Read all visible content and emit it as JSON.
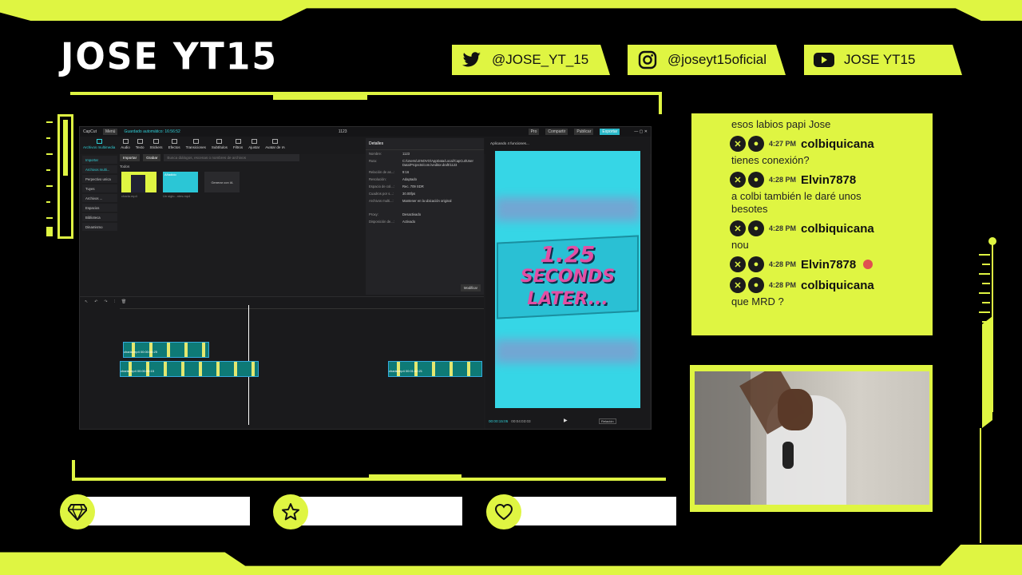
{
  "brand": {
    "name": "JOSE YT15",
    "accent": "#dff542"
  },
  "socials": [
    {
      "icon": "twitter-icon",
      "handle": "@JOSE_YT_15"
    },
    {
      "icon": "instagram-icon",
      "handle": "@joseyt15oficial"
    },
    {
      "icon": "youtube-icon",
      "handle": "JOSE YT15"
    }
  ],
  "editor": {
    "app_name": "CapCut",
    "menu_label": "Menú",
    "autosave": "Guardado automático: 16:56:52",
    "project_title": "1123",
    "top_buttons": [
      "Pro",
      "Compartir",
      "Publicar",
      "Exportar"
    ],
    "toolbar": [
      "Archivos multimedia",
      "Audio",
      "Texto",
      "Stickers",
      "Efectos",
      "Transiciones",
      "Subtítulos",
      "Filtros",
      "Ajustar",
      "Avatar de IA"
    ],
    "sidebar": [
      "Importar",
      "Archivos multi...",
      "Perpectivo unica",
      "Tuyes",
      "Archivos ...",
      "Espacios",
      "Biblioteca",
      "Dinamismo"
    ],
    "media_buttons": [
      "Importar",
      "Grabar"
    ],
    "search_placeholder": "Busca diálogos, escenas o nombres de archivos",
    "filter_label": "Todos",
    "thumbs": [
      {
        "name": "charla.mp4",
        "tag": ""
      },
      {
        "name": "Un siglo...ntes.mp4",
        "tag": "Añadido"
      },
      {
        "name": "Generar con IA",
        "tag": ""
      }
    ],
    "details": {
      "title": "Detalles",
      "rows": [
        {
          "k": "Nombre:",
          "v": "1123"
        },
        {
          "k": "Ruta:",
          "v": "C:/Users/LENOVO/AppData/Local/CapCut/User Data/Projects/com.lveditor.draft/1123"
        },
        {
          "k": "Relación de as...:",
          "v": "9:16"
        },
        {
          "k": "Resolución:",
          "v": "Adaptado"
        },
        {
          "k": "Espacio de col...:",
          "v": "Rec. 709 SDR"
        },
        {
          "k": "Cuadros por s...:",
          "v": "30.00fps"
        },
        {
          "k": "Archivos multi...:",
          "v": "Mantener en la ubicación original"
        },
        {
          "k": "Proxy:",
          "v": "Desactivado"
        },
        {
          "k": "Disposición de...:",
          "v": "Activado"
        }
      ],
      "modify_button": "Modificar"
    },
    "player": {
      "header": "Aplicando 4 funciones...",
      "current_time": "00:00:15:05",
      "total_time": "00:04:03:03",
      "ratio_button": "Relación",
      "video_lines": [
        "1.25",
        "SECONDS",
        "LATER..."
      ]
    },
    "timeline": {
      "clips": [
        "charla.mp4  00:00:08:25",
        "charla.mp4  00:00:06:15",
        "Mejorando la calidad de ima...",
        "charla.mp4",
        "charla.mp4",
        "Un si...",
        "charla.mp4  00:01:42:21"
      ]
    }
  },
  "chat": {
    "messages": [
      {
        "user": "",
        "time": "",
        "text": "esos labios papi Jose"
      },
      {
        "user": "colbiquicana",
        "time": "4:27 PM",
        "text": "tienes conexión?"
      },
      {
        "user": "Elvin7878",
        "time": "4:28 PM",
        "text": "a colbi también le daré unos besotes"
      },
      {
        "user": "colbiquicana",
        "time": "4:28 PM",
        "text": "nou"
      },
      {
        "user": "Elvin7878",
        "time": "4:28 PM",
        "text": ""
      },
      {
        "user": "colbiquicana",
        "time": "4:28 PM",
        "text": "que MRD ?"
      }
    ]
  },
  "goals": [
    {
      "icon": "diamond-icon"
    },
    {
      "icon": "star-icon"
    },
    {
      "icon": "heart-icon"
    }
  ]
}
